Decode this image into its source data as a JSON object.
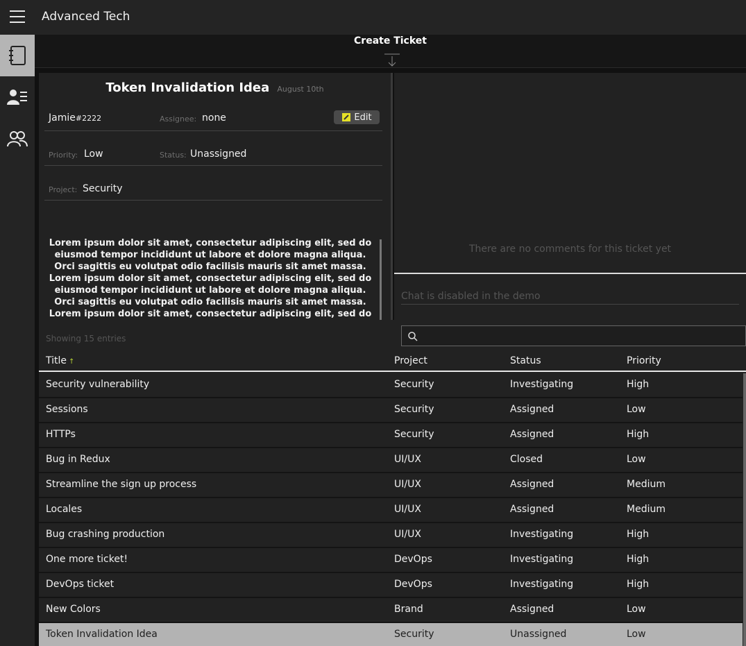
{
  "header": {
    "app_title": "Advanced Tech",
    "menu_icon": "hamburger-icon"
  },
  "sidebar": {
    "items": [
      {
        "icon": "notebook-icon",
        "active": true
      },
      {
        "icon": "user-list-icon",
        "active": false
      },
      {
        "icon": "users-icon",
        "active": false
      }
    ]
  },
  "create_ticket": {
    "label": "Create Ticket",
    "icon": "arrow-down-icon"
  },
  "ticket": {
    "title": "Token Invalidation Idea",
    "date": "August 10th",
    "author_name": "Jamie",
    "author_tag": "#2222",
    "assignee_label": "Assignee:",
    "assignee_value": "none",
    "edit_label": "Edit",
    "priority_label": "Priority:",
    "priority_value": "Low",
    "status_label": "Status:",
    "status_value": "Unassigned",
    "project_label": "Project:",
    "project_value": "Security",
    "description": "Lorem ipsum dolor sit amet, consectetur adipiscing elit, sed do eiusmod tempor incididunt ut labore et dolore magna aliqua. Orci sagittis eu volutpat odio facilisis mauris sit amet massa. Lorem ipsum dolor sit amet, consectetur adipiscing elit, sed do eiusmod tempor incididunt ut labore et dolore magna aliqua. Orci sagittis eu volutpat odio facilisis mauris sit amet massa. Lorem ipsum dolor sit amet, consectetur adipiscing elit, sed do eiusmod tempor incididunt ut labore et dolore magna aliqua. Orci sagittis eu volutpat odio facilisis mauris sit amet massa."
  },
  "comments": {
    "empty_text": "There are no comments for this ticket yet",
    "chat_placeholder": "Chat is disabled in the demo"
  },
  "table": {
    "showing_text": "Showing 15 entries",
    "search_icon": "search-icon",
    "sort_indicator": "↑",
    "columns": [
      "Title",
      "Project",
      "Status",
      "Priority"
    ],
    "rows": [
      {
        "title": "Security vulnerability",
        "project": "Security",
        "status": "Investigating",
        "priority": "High"
      },
      {
        "title": "Sessions",
        "project": "Security",
        "status": "Assigned",
        "priority": "Low"
      },
      {
        "title": "HTTPs",
        "project": "Security",
        "status": "Assigned",
        "priority": "High"
      },
      {
        "title": "Bug in Redux",
        "project": "UI/UX",
        "status": "Closed",
        "priority": "Low"
      },
      {
        "title": "Streamline the sign up process",
        "project": "UI/UX",
        "status": "Assigned",
        "priority": "Medium"
      },
      {
        "title": "Locales",
        "project": "UI/UX",
        "status": "Assigned",
        "priority": "Medium"
      },
      {
        "title": "Bug crashing production",
        "project": "UI/UX",
        "status": "Investigating",
        "priority": "High"
      },
      {
        "title": "One more ticket!",
        "project": "DevOps",
        "status": "Investigating",
        "priority": "High"
      },
      {
        "title": "DevOps ticket",
        "project": "DevOps",
        "status": "Investigating",
        "priority": "High"
      },
      {
        "title": "New Colors",
        "project": "Brand",
        "status": "Assigned",
        "priority": "Low"
      },
      {
        "title": "Token Invalidation Idea",
        "project": "Security",
        "status": "Unassigned",
        "priority": "Low",
        "selected": true
      }
    ]
  },
  "colors": {
    "accent": "#b5d334",
    "selected_row": "#b3b3b3",
    "edit_icon": "#e5e027"
  }
}
